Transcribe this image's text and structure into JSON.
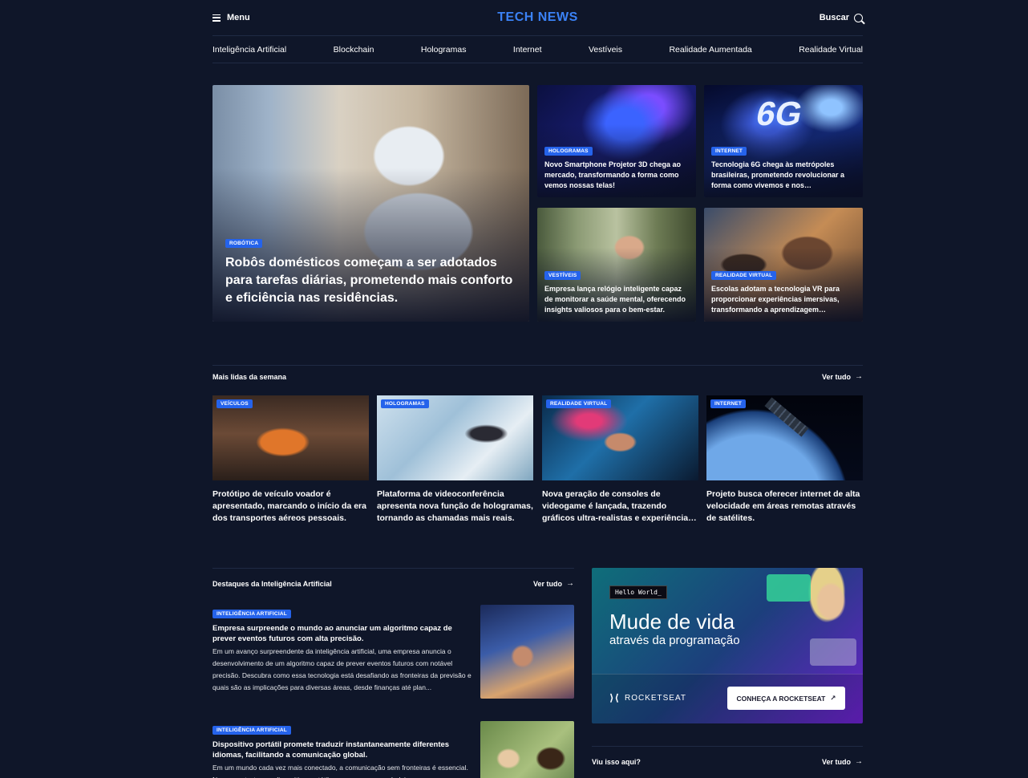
{
  "header": {
    "menu_label": "Menu",
    "logo": "TECH NEWS",
    "search_label": "Buscar"
  },
  "nav": [
    "Inteligência Artificial",
    "Blockchain",
    "Hologramas",
    "Internet",
    "Vestíveis",
    "Realidade Aumentada",
    "Realidade Virtual"
  ],
  "hero": {
    "main": {
      "badge": "ROBÓTICA",
      "title": "Robôs domésticos começam a ser adotados para tarefas diárias, prometendo mais conforto e eficiência nas residências."
    },
    "items": [
      {
        "badge": "HOLOGRAMAS",
        "title": "Novo Smartphone Projetor 3D chega ao mercado, transformando a forma como vemos nossas telas!"
      },
      {
        "badge": "INTERNET",
        "title": "Tecnologia 6G chega às metrópoles brasileiras, prometendo revolucionar a forma como vivemos e nos comunicamos."
      },
      {
        "badge": "VESTÍVEIS",
        "title": "Empresa lança relógio inteligente capaz de monitorar a saúde mental, oferecendo insights valiosos para o bem-estar."
      },
      {
        "badge": "REALIDADE VIRTUAL",
        "title": "Escolas adotam a tecnologia VR para proporcionar experiências imersivas, transformando a aprendizagem tradicional."
      }
    ],
    "six_g_text": "6G"
  },
  "mais_lidas": {
    "title": "Mais lidas da semana",
    "more": "Ver tudo",
    "items": [
      {
        "badge": "VEÍCULOS",
        "title": "Protótipo de veículo voador é apresentado, marcando o início da era dos transportes aéreos pessoais."
      },
      {
        "badge": "HOLOGRAMAS",
        "title": "Plataforma de videoconferência apresenta nova função de hologramas, tornando as chamadas mais reais."
      },
      {
        "badge": "REALIDADE VIRTUAL",
        "title": "Nova geração de consoles de videogame é lançada, trazendo gráficos ultra-realistas e experiências imersivas."
      },
      {
        "badge": "INTERNET",
        "title": "Projeto busca oferecer internet de alta velocidade em áreas remotas através de satélites."
      }
    ]
  },
  "destaques": {
    "title": "Destaques da Inteligência Artificial",
    "more": "Ver tudo",
    "items": [
      {
        "badge": "INTELIGÊNCIA ARTIFICIAL",
        "title": "Empresa surpreende o mundo ao anunciar um algoritmo capaz de prever eventos futuros com alta precisão.",
        "body": "Em um avanço surpreendente da inteligência artificial, uma empresa anuncia o desenvolvimento de um algoritmo capaz de prever eventos futuros com notável precisão. Descubra como essa tecnologia está desafiando as fronteiras da previsão e quais são as implicações para diversas áreas, desde finanças até plan..."
      },
      {
        "badge": "INTELIGÊNCIA ARTIFICIAL",
        "title": "Dispositivo portátil promete traduzir instantaneamente diferentes idiomas, facilitando a comunicação global.",
        "body": "Em um mundo cada vez mais conectado, a comunicação sem fronteiras é essencial. Nesse contexto, um dispositivo portátil surge como um verdadeiro"
      }
    ]
  },
  "ad": {
    "hello": "Hello World_",
    "headline": "Mude de vida",
    "subline": "através da programação",
    "brand": "ROCKETSEAT",
    "cta": "CONHEÇA A ROCKETSEAT",
    "colors": {
      "start": "#0f6e7a",
      "mid": "#1c3f7c",
      "end": "#6a21c9"
    }
  },
  "viu": {
    "title": "Viu isso aqui?",
    "more": "Ver tudo"
  },
  "colors": {
    "background": "#0f1629",
    "accent": "#3b82f6",
    "badge": "#2563eb"
  }
}
